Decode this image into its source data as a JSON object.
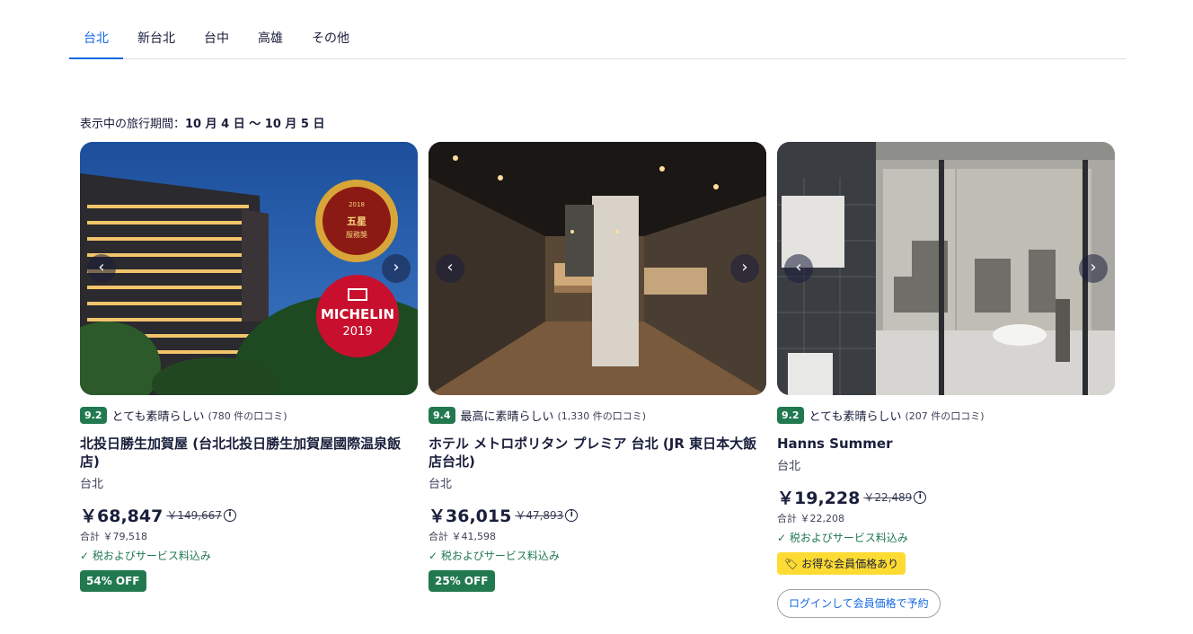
{
  "tabs": [
    {
      "label": "台北",
      "active": true
    },
    {
      "label": "新台北",
      "active": false
    },
    {
      "label": "台中",
      "active": false
    },
    {
      "label": "高雄",
      "active": false
    },
    {
      "label": "その他",
      "active": false
    }
  ],
  "period": {
    "label": "表示中の旅行期間：",
    "dates": "10 月 4 日 〜 10 月 5 日"
  },
  "hotels": [
    {
      "score": "9.2",
      "rating_label": "とても素晴らしい",
      "reviews": "(780 件の口コミ)",
      "name": "北投日勝生加賀屋 (台北北投日勝生加賀屋國際温泉飯店)",
      "city": "台北",
      "price": "￥68,847",
      "original_price": "￥149,667",
      "total": "合計 ￥79,518",
      "tax": "✓ 税およびサービス料込み",
      "badge": "54% OFF",
      "image_badge_1": "2018旅遊雜誌 五星服務獎",
      "image_badge_2_line1": "MICHELIN",
      "image_badge_2_line2": "2019"
    },
    {
      "score": "9.4",
      "rating_label": "最高に素晴らしい",
      "reviews": "(1,330 件の口コミ)",
      "name": "ホテル メトロポリタン プレミア 台北 (JR 東日本大飯店台北)",
      "city": "台北",
      "price": "￥36,015",
      "original_price": "￥47,893",
      "total": "合計 ￥41,598",
      "tax": "✓ 税およびサービス料込み",
      "badge": "25% OFF"
    },
    {
      "score": "9.2",
      "rating_label": "とても素晴らしい",
      "reviews": "(207 件の口コミ)",
      "name": "Hanns Summer",
      "city": "台北",
      "price": "￥19,228",
      "original_price": "￥22,489",
      "total": "合計 ￥22,208",
      "tax": "✓ 税およびサービス料込み",
      "member_badge": "お得な会員価格あり",
      "login_button": "ログインして会員価格で予約"
    }
  ],
  "icons": {
    "prev": "chevron-left-icon",
    "next": "chevron-right-icon",
    "info": "info-icon",
    "check": "check-icon",
    "tag": "tag-icon"
  },
  "colors": {
    "accent": "#1668e3",
    "score_green": "#227950",
    "member_yellow": "#fddb32",
    "text": "#191e3b"
  }
}
